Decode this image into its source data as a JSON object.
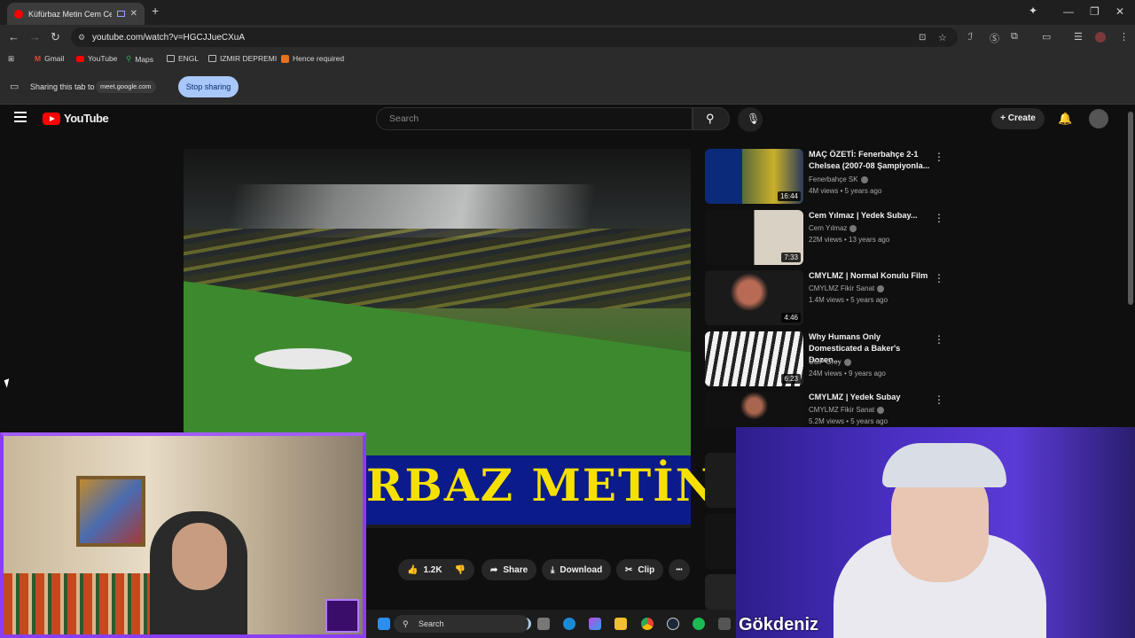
{
  "browser": {
    "tab_title": "Küfürbaz Metin Cem Cemin",
    "new_tab_icon": "plus-icon",
    "url": "youtube.com/watch?v=HGCJJueCXuA",
    "window_controls": [
      "—",
      "❐",
      "✕"
    ]
  },
  "bookmarks": [
    {
      "label": "Gmail",
      "icon": "gmail-icon"
    },
    {
      "label": "YouTube",
      "icon": "youtube-icon"
    },
    {
      "label": "Maps",
      "icon": "maps-icon"
    },
    {
      "label": "ENGL",
      "icon": "folder-icon"
    },
    {
      "label": "IZMIR DEPREMI",
      "icon": "folder-icon"
    },
    {
      "label": "Hence required",
      "icon": "bookmark-icon"
    }
  ],
  "share_bar": {
    "label": "Sharing this tab to",
    "target": "meet.google.com",
    "stop_label": "Stop sharing"
  },
  "youtube": {
    "logo_text": "YouTube",
    "search_placeholder": "Search",
    "create_label": "Create",
    "accent": "#ff0000"
  },
  "video": {
    "caption_text": "RBAZ METİN"
  },
  "actions": {
    "likes": "1.2K",
    "share": "Share",
    "download": "Download",
    "clip": "Clip",
    "more": "•••"
  },
  "recommendations": [
    {
      "title": "MAÇ ÖZETİ: Fenerbahçe 2-1 Chelsea (2007-08 Şampiyonla...",
      "channel": "Fenerbahçe SK",
      "meta": "4M views • 5 years ago",
      "duration": "16:44"
    },
    {
      "title": "Cem Yılmaz | Yedek Subay...",
      "channel": "Cem Yılmaz",
      "meta": "22M views • 13 years ago",
      "duration": "7:33"
    },
    {
      "title": "CMYLMZ | Normal Konulu Film",
      "channel": "CMYLMZ Fikir Sanat",
      "meta": "1.4M views • 5 years ago",
      "duration": "4:46"
    },
    {
      "title": "Why Humans Only Domesticated a Baker's Dozen...",
      "channel": "CGP Grey",
      "meta": "24M views • 9 years ago",
      "duration": "6:23"
    },
    {
      "title": "CMYLMZ | Yedek Subay",
      "channel": "CMYLMZ Fikir Sanat",
      "meta": "5.2M views • 5 years ago",
      "duration": ""
    }
  ],
  "webcam": {
    "name": "Gökdeniz"
  },
  "taskbar": {
    "search_label": "Search"
  }
}
